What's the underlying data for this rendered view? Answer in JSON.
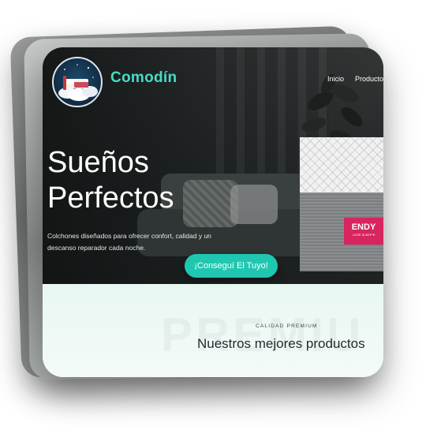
{
  "header": {
    "brand": "Comodín",
    "nav": [
      "Inicio",
      "Producto"
    ]
  },
  "hero": {
    "title_line1": "Sueños",
    "title_line2": "Perfectos",
    "description": "Colchones diseñados para ofrecer confort, calidad y un descanso reparador cada noche.",
    "cta_label": "¡Conseguí El Tuyo!"
  },
  "product_image": {
    "label_brand": "ENDY",
    "label_tagline": "LOVE SLEEP ♥"
  },
  "products": {
    "eyebrow": "CALIDAD PREMIUM",
    "title": "Nuestros mejores productos",
    "watermark": "PREMIU"
  },
  "colors": {
    "accent": "#46dcc6",
    "cta": "#1fc7b1",
    "label": "#d8245f"
  },
  "icons": {
    "logo": "bed-on-clouds-logo"
  }
}
